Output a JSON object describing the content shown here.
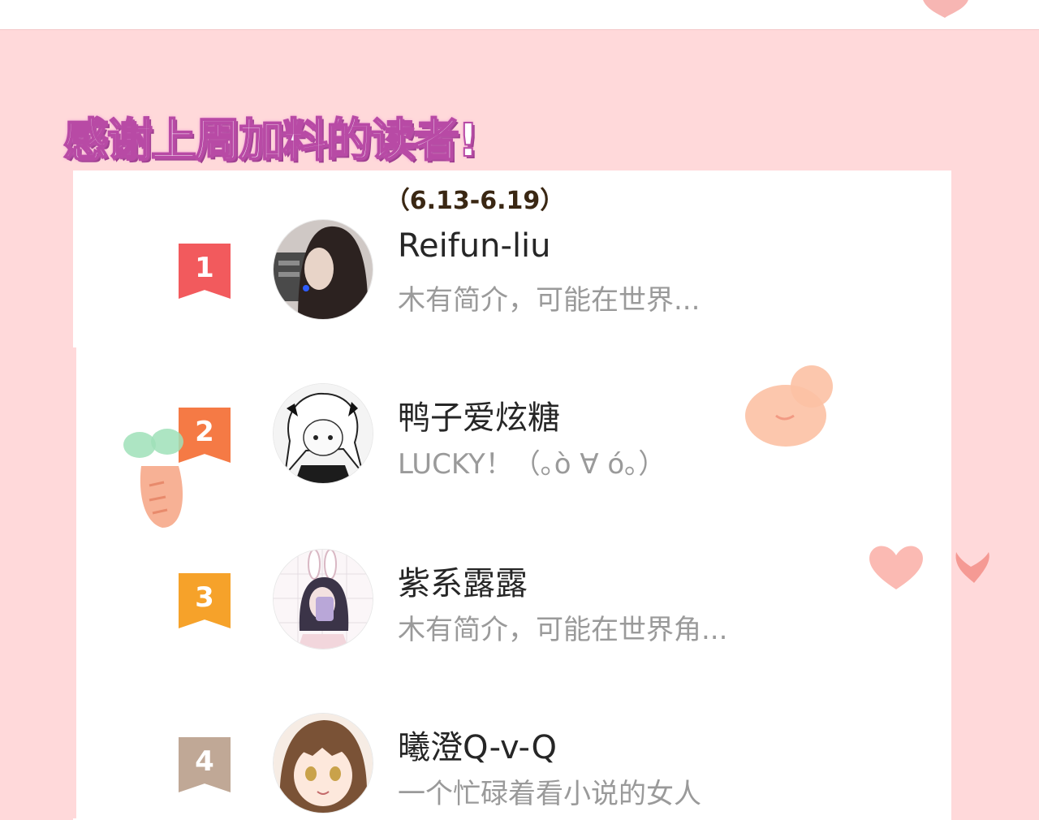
{
  "header": {
    "title": "感谢上周加料的读者!",
    "date_range": "（6.13-6.19）"
  },
  "readers": [
    {
      "rank": "1",
      "name": "Reifun-liu",
      "bio": "木有简介，可能在世界...",
      "badge_color": "#f25a5d"
    },
    {
      "rank": "2",
      "name": "鸭子爱炫糖",
      "bio": "LUCKY！（｡ò ∀ ó｡）",
      "badge_color": "#f57a45"
    },
    {
      "rank": "3",
      "name": "紫系露露",
      "bio": "木有简介，可能在世界角...",
      "badge_color": "#f6a22a"
    },
    {
      "rank": "4",
      "name": "曦澄Q-v-Q",
      "bio": "一个忙碌着看小说的女人",
      "badge_color": "#c0a896"
    }
  ],
  "colors": {
    "background": "#ffd9da",
    "panel": "#ffffff",
    "title_outline": "#b84aa5"
  }
}
